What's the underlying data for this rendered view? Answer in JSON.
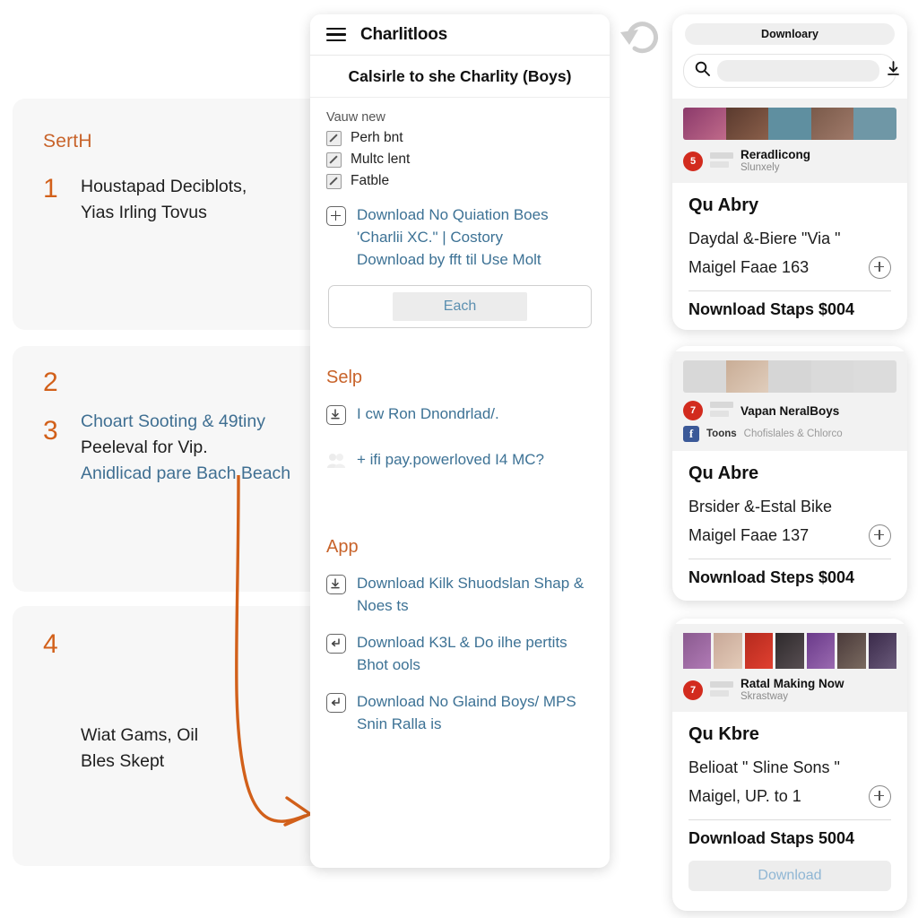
{
  "colors": {
    "accent_orange": "#d2601a",
    "link_blue": "#3d7295",
    "badge_red": "#d22b1e",
    "facebook_blue": "#3b5998",
    "card_bg": "#f7f7f7"
  },
  "left_steps": [
    {
      "section_label": "SertH",
      "number": "1",
      "lines": [
        {
          "text": "Houstapad Deciblots,",
          "link": false
        },
        {
          "text": "Yias Irling Tovus",
          "link": false
        }
      ]
    },
    {
      "section_label": "",
      "number": "2",
      "lines": []
    },
    {
      "section_label": "",
      "number": "3",
      "lines": [
        {
          "text": "Choart Sooting & 49tiny",
          "link": true
        },
        {
          "text": "Peeleval for Vip.",
          "link": false
        },
        {
          "text": "Anidlicad pare Bach Beach",
          "link": true
        }
      ]
    },
    {
      "section_label": "",
      "number": "4",
      "lines": [
        {
          "text": "Wiat Gams, Oil",
          "link": false
        },
        {
          "text": "Bles Skept",
          "link": false
        }
      ]
    }
  ],
  "middle": {
    "menu_icon": "hamburger-icon",
    "title": "Charlitloos",
    "subtitle": "Calsirle to she Charlity (Boys)",
    "sections": [
      {
        "title": "",
        "small_label": "Vauw new",
        "checkboxes": [
          {
            "label": "Perh bnt",
            "icon": "checkbox-slash-icon"
          },
          {
            "label": "Multc lent",
            "icon": "checkbox-slash-icon"
          },
          {
            "label": "Fatble",
            "icon": "checkbox-slash-icon"
          }
        ],
        "links": [
          {
            "icon": "plus-box-icon",
            "line1": "Download No Quiation Boes",
            "line2": "'Charlii XC.\" | Costory",
            "line3": "Download by fft til Use Molt"
          }
        ],
        "button": {
          "label": "Each",
          "name": "each-button"
        }
      },
      {
        "title": "Selp",
        "links": [
          {
            "icon": "download-box-icon",
            "line1": "I cw Ron Dnondrlad/.",
            "line2": "",
            "line3": ""
          },
          {
            "icon": "people-icon",
            "line1": "+ ifi pay.powerloved I4 MC?",
            "line2": "",
            "line3": ""
          }
        ]
      },
      {
        "title": "App",
        "links": [
          {
            "icon": "download-box-icon",
            "line1": "Download Kilk Shuodslan Shap &",
            "line2": "Noes ts",
            "line3": ""
          },
          {
            "icon": "enter-box-icon",
            "line1": "Download K3L & Do ilhe pertits",
            "line2": "Bhot ools",
            "line3": ""
          },
          {
            "icon": "enter-box-icon",
            "line1": "Download No Glaind Boys/ MPS",
            "line2": "Snin Ralla is",
            "line3": ""
          }
        ]
      }
    ]
  },
  "undo_icon": "undo-arrow-icon",
  "right_cards": [
    {
      "pill_label": "Downloary",
      "search": {
        "icon": "search-icon",
        "placeholder": "",
        "value": "",
        "action_icon": "download-arrow-icon"
      },
      "story": {
        "badge": "5",
        "title": "Reradlicong",
        "subtitle": "Slunxely",
        "thumb_colors": [
          "#6d4a7a",
          "#5a3a2e",
          "#5f8fa0",
          "#6a8fa0",
          "#6f97a6"
        ],
        "facebook": null
      },
      "title": "Qu Abry",
      "line1": "Daydal &-Biere \"Via \"",
      "line2": "Maigel Faae 163",
      "plus_icon": "plus-circle-icon",
      "steps_label": "Nownload Staps  $004",
      "download_button": null
    },
    {
      "pill_label": null,
      "search": null,
      "story": {
        "badge": "7",
        "title": "Vapan NeralBoys",
        "subtitle": "",
        "thumb_colors": [
          "#d8d8d8",
          "#bfa99a",
          "#d4d4d4",
          "#d8d8d8",
          "#dcdcdc"
        ],
        "facebook": {
          "icon": "facebook-icon",
          "label": "Toons",
          "sub": "Chofislales & Chlorco"
        }
      },
      "title": "Qu Abre",
      "line1": "Brsider &-Estal Bike",
      "line2": "Maigel Faae 137",
      "plus_icon": "plus-circle-icon",
      "steps_label": "Nownload Steps  $004",
      "download_button": null
    },
    {
      "pill_label": null,
      "search": null,
      "story": {
        "badge": "7",
        "title": "Ratal Making Now",
        "subtitle": "Skrastway",
        "thumb_colors": [
          "#8a5a8f",
          "#c8a898",
          "#b52a1e",
          "#2e2a2c",
          "#6a3a8a",
          "#4a3a3a",
          "#3a2a4a"
        ],
        "facebook": null
      },
      "title": "Qu Kbre",
      "line1": "Belioat \" Sline Sons \"",
      "line2": "Maigel, UP. to 1",
      "plus_icon": "plus-circle-icon",
      "steps_label": "Download Staps  5004",
      "download_button": {
        "label": "Download",
        "name": "download-button"
      }
    }
  ],
  "arrow": {
    "name": "curved-flow-arrow",
    "color": "#d2601a"
  }
}
